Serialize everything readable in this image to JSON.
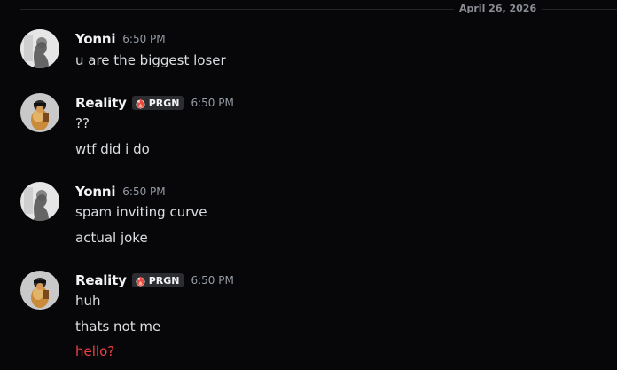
{
  "date_divider": "April 26, 2026",
  "messages": [
    {
      "author": "Yonni",
      "tag": "",
      "time": "6:50 PM",
      "lines": [
        "u are the biggest loser"
      ]
    },
    {
      "author": "Reality",
      "tag": "PRGN",
      "time": "6:50 PM",
      "lines": [
        "??",
        "wtf did i do"
      ]
    },
    {
      "author": "Yonni",
      "tag": "",
      "time": "6:50 PM",
      "lines": [
        "spam inviting curve",
        "actual joke"
      ]
    },
    {
      "author": "Reality",
      "tag": "PRGN",
      "time": "6:50 PM",
      "lines": [
        "huh",
        "thats not me",
        "hello?"
      ]
    }
  ],
  "colors": {
    "background": "#070709",
    "username": "#f2f3f5",
    "message_text": "#dbdee1",
    "timestamp": "#949ba4",
    "failed_message": "#f23f43",
    "tag_background": "#2b2d31"
  },
  "icons": {
    "tag_icon": "flame-icon",
    "avatar_yonni": "avatar",
    "avatar_reality": "avatar"
  }
}
